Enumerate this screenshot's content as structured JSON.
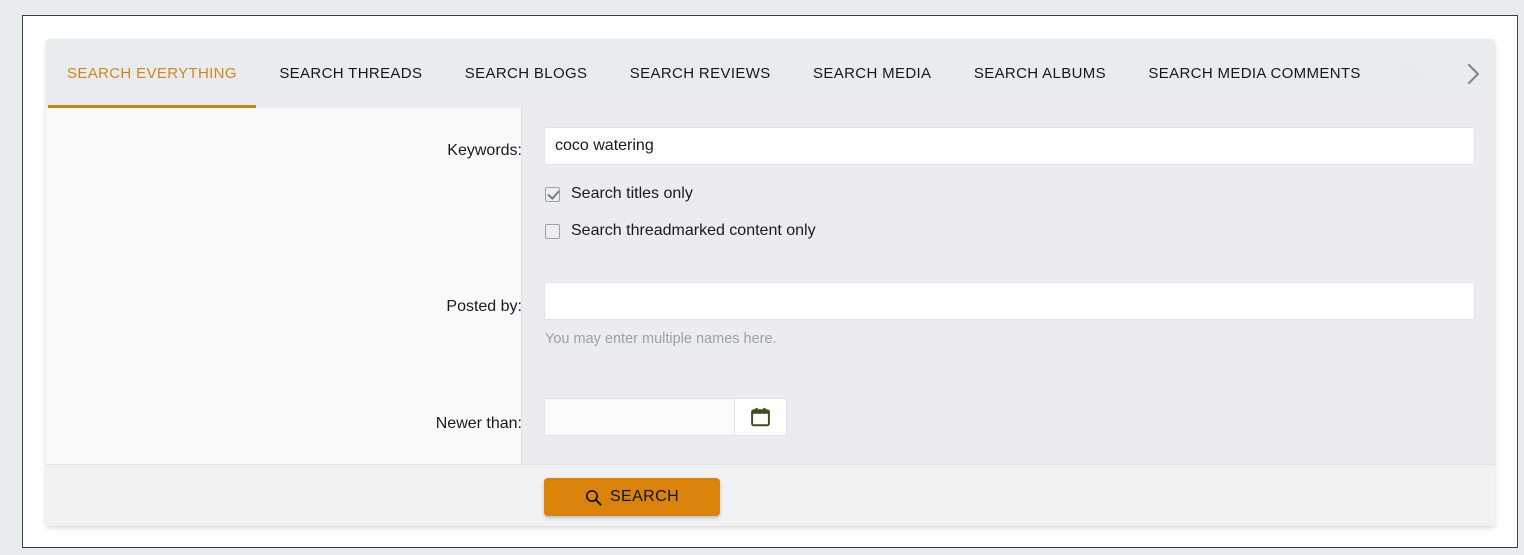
{
  "tabs": [
    {
      "label": "Search everything",
      "active": true,
      "clipped": false
    },
    {
      "label": "Search threads",
      "active": false,
      "clipped": false
    },
    {
      "label": "Search blogs",
      "active": false,
      "clipped": false
    },
    {
      "label": "Search reviews",
      "active": false,
      "clipped": false
    },
    {
      "label": "Search media",
      "active": false,
      "clipped": false
    },
    {
      "label": "Search albums",
      "active": false,
      "clipped": false
    },
    {
      "label": "Search media comments",
      "active": false,
      "clipped": false
    },
    {
      "label": "SE",
      "active": false,
      "clipped": true
    }
  ],
  "tab_nav": {
    "next_icon": "chevron-right-icon"
  },
  "form": {
    "keywords": {
      "label": "Keywords:",
      "value": "coco watering",
      "placeholder": ""
    },
    "checkboxes": [
      {
        "label": "Search titles only",
        "checked": true
      },
      {
        "label": "Search threadmarked content only",
        "checked": false
      }
    ],
    "posted_by": {
      "label": "Posted by:",
      "value": "",
      "placeholder": "",
      "hint": "You may enter multiple names here."
    },
    "newer_than": {
      "label": "Newer than:",
      "value": "",
      "placeholder": "",
      "picker_icon": "calendar-icon"
    }
  },
  "footer": {
    "search_button": {
      "label": "Search",
      "icon": "search-icon"
    }
  },
  "colors": {
    "accent": "#d9830b",
    "active_tab_text": "#d1861c",
    "calendar_icon": "#3f4f1f",
    "tab_bar_bg": "#e9ecee",
    "content_bg": "#eaecef",
    "rail_bg": "#f8f9f9",
    "footer_bg": "#f1f2f3",
    "page_bg": "#e7ecee"
  }
}
